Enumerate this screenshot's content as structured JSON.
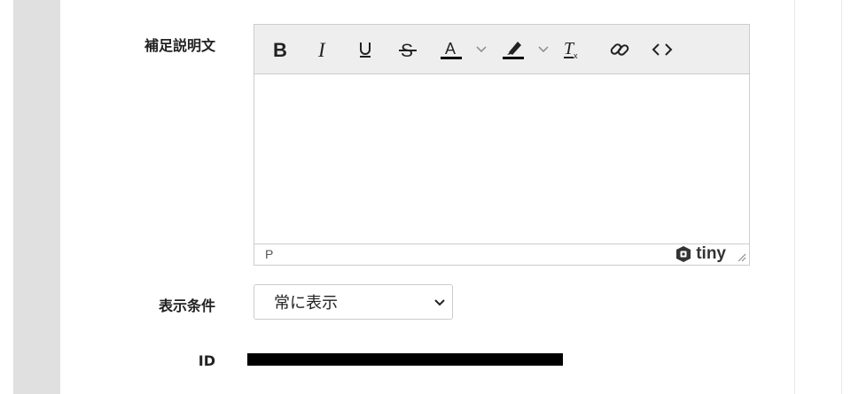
{
  "labels": {
    "description": "補足説明文",
    "display_condition": "表示条件",
    "id": "ID"
  },
  "editor": {
    "toolbar": [
      "bold-icon",
      "italic-icon",
      "underline-icon",
      "strikethrough-icon",
      "text-color-icon",
      "highlight-color-icon",
      "clear-format-icon",
      "link-icon",
      "source-code-icon"
    ],
    "content": "",
    "statusbar_path": "P",
    "brand": "tiny"
  },
  "display_condition": {
    "selected": "常に表示"
  },
  "id_value_redacted": true
}
